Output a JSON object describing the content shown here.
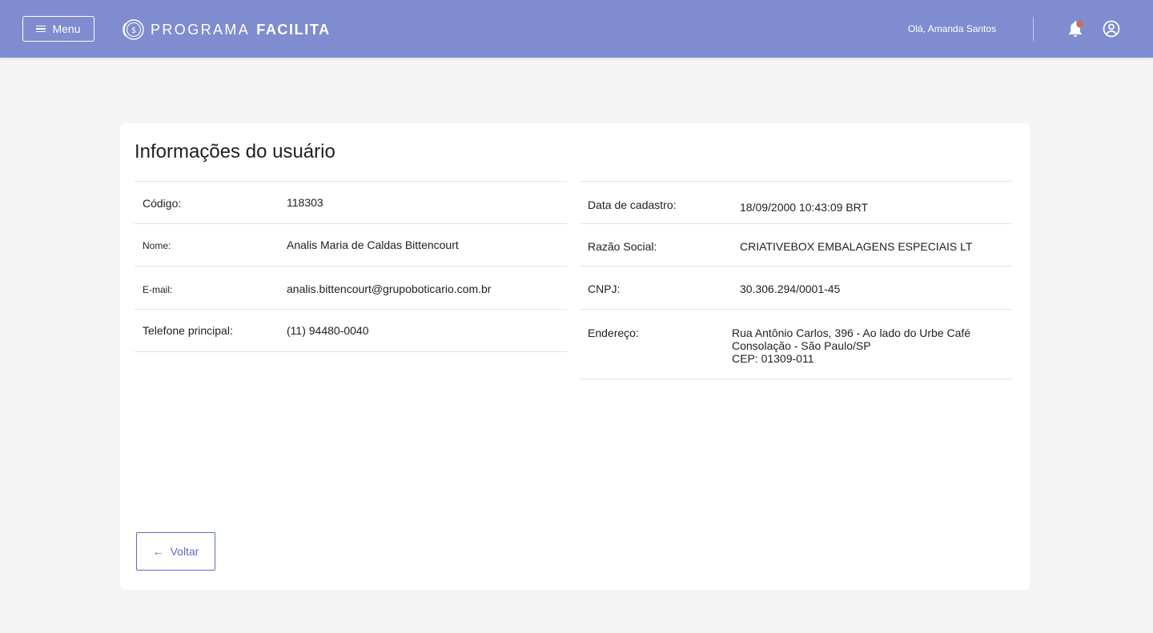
{
  "header": {
    "menu_label": "Menu",
    "brand_light": "PROGRAMA",
    "brand_bold": "FACILITA",
    "greeting": "Olá, Amanda Santos",
    "accent_color": "#7f8ccf",
    "notification_dot_color": "#e8623a"
  },
  "page": {
    "title": "Informações do usuário",
    "back_label": "Voltar"
  },
  "left_fields": [
    {
      "label": "Código:",
      "value": "118303"
    },
    {
      "label": "Nome:",
      "value": "Analis Maria de Caldas Bittencourt"
    },
    {
      "label": "E-mail:",
      "value": "analis.bittencourt@grupoboticario.com.br"
    },
    {
      "label": "Telefone principal:",
      "value": "(11) 94480-0040"
    }
  ],
  "right_fields": [
    {
      "label": "Data de cadastro:",
      "value": "18/09/2000 10:43:09 BRT"
    },
    {
      "label": "Razão Social:",
      "value": "CRIATIVEBOX EMBALAGENS ESPECIAIS LT"
    },
    {
      "label": "CNPJ:",
      "value": "30.306.294/0001-45"
    },
    {
      "label": "Endereço:",
      "value_lines": [
        "Rua Antônio Carlos, 396 - Ao lado do Urbe Café",
        "Consolação - São Paulo/SP",
        "CEP: 01309-011"
      ]
    }
  ]
}
